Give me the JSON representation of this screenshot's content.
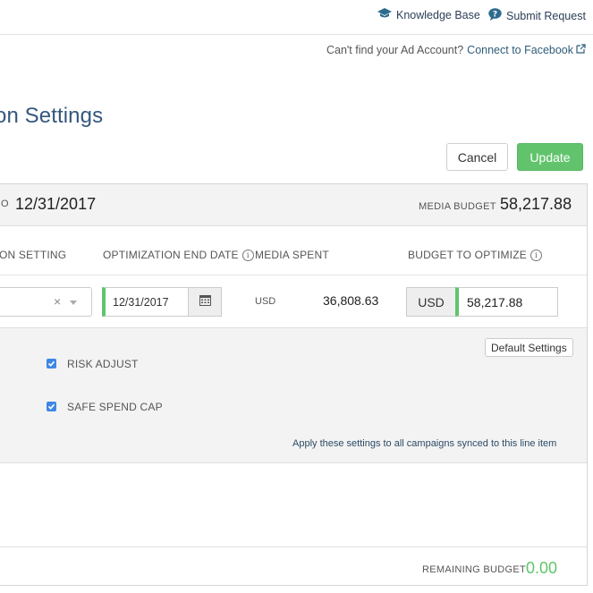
{
  "top_links": {
    "knowledge_base": "Knowledge Base",
    "submit_request": "Submit Request"
  },
  "facebook_prompt": {
    "text": "Can't find your Ad Account?",
    "link": "Connect to Facebook"
  },
  "page_title": "on Settings",
  "buttons": {
    "cancel": "Cancel",
    "update": "Update"
  },
  "header": {
    "date_prefix": "O",
    "date": "12/31/2017",
    "media_budget_label": "MEDIA BUDGET",
    "media_budget_value": "58,217.88"
  },
  "columns": {
    "setting": "ON SETTING",
    "end_date": "OPTIMIZATION END DATE",
    "media_spent": "MEDIA SPENT",
    "budget_to_optimize": "BUDGET TO OPTIMIZE"
  },
  "row": {
    "end_date_value": "12/31/2017",
    "spent_currency": "USD",
    "spent_value": "36,808.63",
    "budget_currency": "USD",
    "budget_value": "58,217.88"
  },
  "settings": {
    "default_button": "Default Settings",
    "risk_adjust": "RISK ADJUST",
    "risk_adjust_checked": true,
    "safe_spend_cap": "SAFE SPEND CAP",
    "safe_spend_cap_checked": true,
    "apply_text": "Apply these settings to all campaigns synced to this line item"
  },
  "footer": {
    "remaining_budget_label": "REMAINING BUDGET",
    "remaining_budget_value": "0.00"
  },
  "colors": {
    "accent_green": "#61c46c",
    "title_blue": "#34577d",
    "checkbox_blue": "#3f87e6"
  },
  "icons": {
    "knowledge_base": "graduation-cap-icon",
    "submit_request": "question-bubble-icon",
    "external_link": "external-link-icon",
    "calendar": "calendar-icon",
    "info": "info-icon",
    "clear": "clear-x-icon",
    "caret": "caret-down-icon"
  }
}
